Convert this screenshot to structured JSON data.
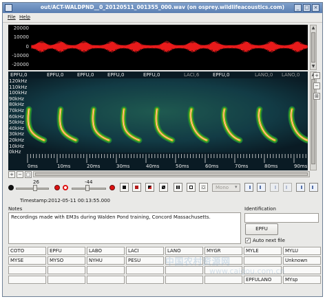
{
  "window": {
    "title": "out/ACT-WALDPND__0_20120511_001355_000.wav (on osprey.wildlifeacoustics.com)",
    "buttons": [
      "_",
      "□",
      "×"
    ]
  },
  "menu": [
    "File",
    "Help"
  ],
  "waveform": {
    "amplitude_ticks": [
      "20000",
      "10000",
      "0",
      "-10000",
      "-20000"
    ],
    "color": "#e81a1a",
    "background": "#000000"
  },
  "spectrogram": {
    "species_labels": [
      "EPFU,0",
      "EPFU,0",
      "EPFU,0",
      "EPFU,0",
      "EPFU,0",
      "LACI,6",
      "EPFU,0",
      "LANO,0",
      "LANO,0"
    ],
    "species_dim": [
      false,
      false,
      false,
      false,
      false,
      true,
      false,
      true,
      true
    ],
    "freq_ticks": [
      "120kHz",
      "110kHz",
      "100kHz",
      "90kHz",
      "80kHz",
      "70kHz",
      "60kHz",
      "50kHz",
      "40kHz",
      "30kHz",
      "20kHz",
      "10kHz",
      "0kHz"
    ],
    "time_ticks": [
      "0ms",
      "10ms",
      "20ms",
      "30ms",
      "40ms",
      "50ms",
      "60ms",
      "70ms",
      "80ms",
      "90ms"
    ],
    "call_count": 9,
    "background": "#0a1b24"
  },
  "side_buttons": [
    "+",
    "−",
    "⊞"
  ],
  "zoom_buttons": [
    "+",
    "−",
    "□"
  ],
  "controls": {
    "record_level": "26",
    "playback_level": "-44",
    "channel_mode": "Mono"
  },
  "timestamp": {
    "label": "Timestamp:",
    "value": "2012-05-11 00:13:55.000"
  },
  "notes": {
    "label": "Notes",
    "text": "Recordings made with EM3s during Walden Pond training, Concord Massachusetts."
  },
  "identification": {
    "label": "Identification",
    "value": "",
    "button_label": "EPFU",
    "auto_next_label": "Auto next file",
    "auto_next_checked": true
  },
  "species_grid": [
    [
      "COTO",
      "EPFU",
      "LABO",
      "LACI",
      "LANO",
      "MYGR",
      "MYLE",
      "MYLU"
    ],
    [
      "MYSE",
      "MYSO",
      "NYHU",
      "PESU",
      "",
      "",
      "",
      "Unknown"
    ],
    [
      "",
      "",
      "",
      "",
      "",
      "",
      "",
      ""
    ],
    [
      "",
      "",
      "",
      "",
      "",
      "",
      "EPFULANO",
      "MYsp"
    ]
  ],
  "watermark": {
    "text": "中国农村资源网",
    "url": "www.caigou.com.cn"
  }
}
